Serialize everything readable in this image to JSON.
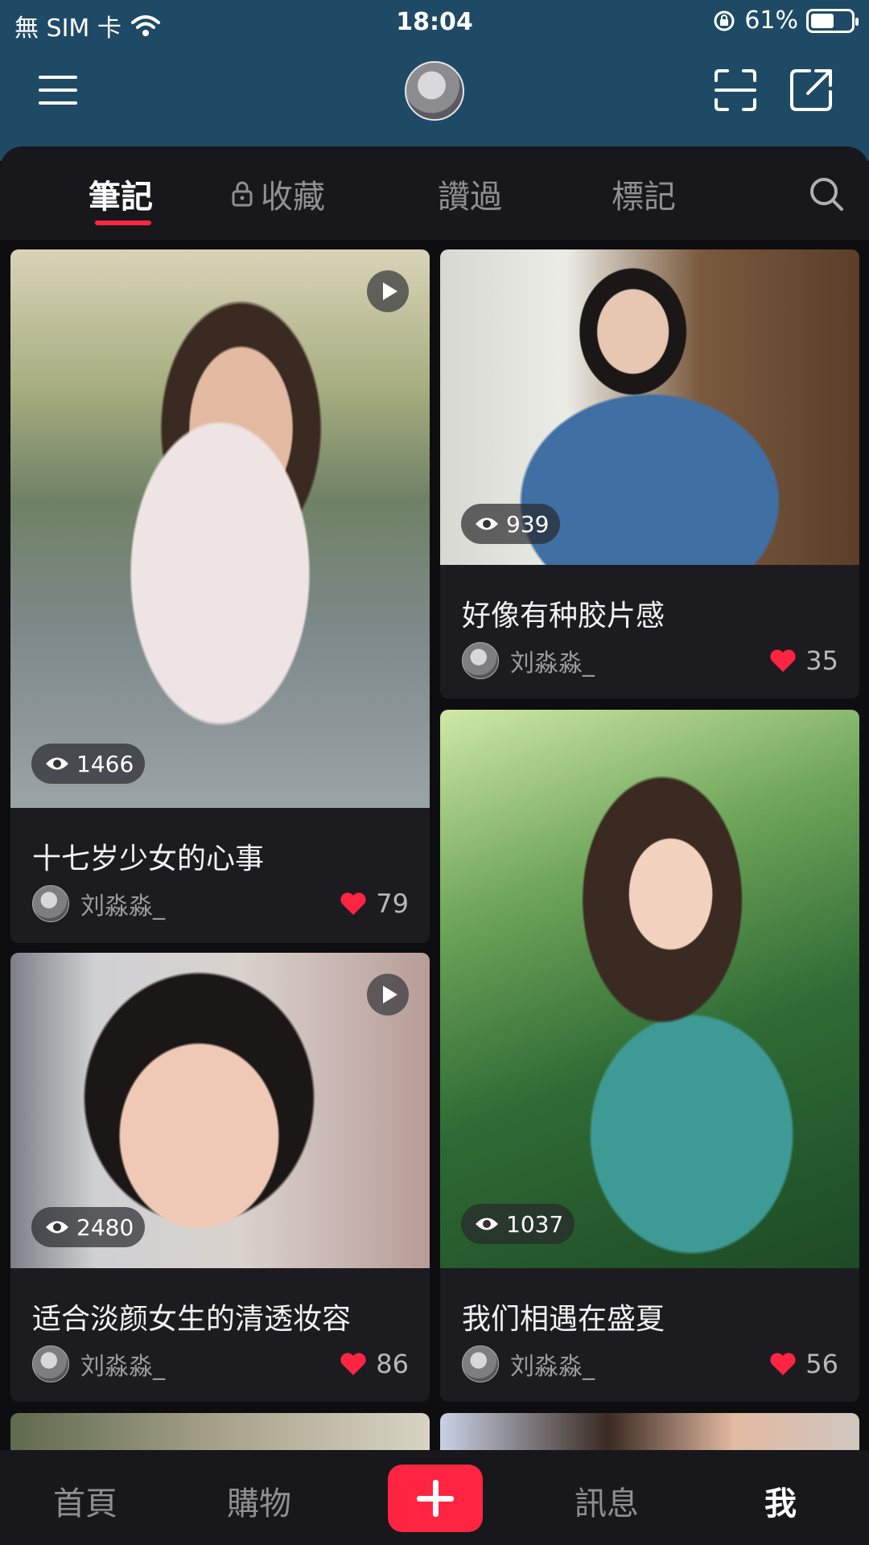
{
  "status": {
    "carrier": "無 SIM 卡",
    "time": "18:04",
    "battery": "61%"
  },
  "tabs": [
    {
      "label": "筆記",
      "active": true
    },
    {
      "label": "收藏",
      "locked": true
    },
    {
      "label": "讚過"
    },
    {
      "label": "標記"
    }
  ],
  "icons": {
    "menu": "hamburger-icon",
    "scan": "scan-icon",
    "share": "share-icon",
    "search": "search-icon",
    "lock": "lock-icon",
    "eye": "eye-icon",
    "heart": "heart-icon",
    "play": "play-icon"
  },
  "posts": [
    {
      "title": "十七岁少女的心事",
      "views": "1466",
      "author": "刘淼淼_",
      "likes": "79",
      "video": true
    },
    {
      "title": "好像有种胶片感",
      "views": "939",
      "author": "刘淼淼_",
      "likes": "35",
      "video": false
    },
    {
      "title": "适合淡颜女生的清透妆容",
      "views": "2480",
      "author": "刘淼淼_",
      "likes": "86",
      "video": true
    },
    {
      "title": "我们相遇在盛夏",
      "views": "1037",
      "author": "刘淼淼_",
      "likes": "56",
      "video": false
    }
  ],
  "nav": {
    "home": "首頁",
    "shop": "購物",
    "messages": "訊息",
    "me": "我"
  },
  "colors": {
    "accent": "#ff2442",
    "header": "#1f4a66",
    "panel": "#18181c"
  }
}
